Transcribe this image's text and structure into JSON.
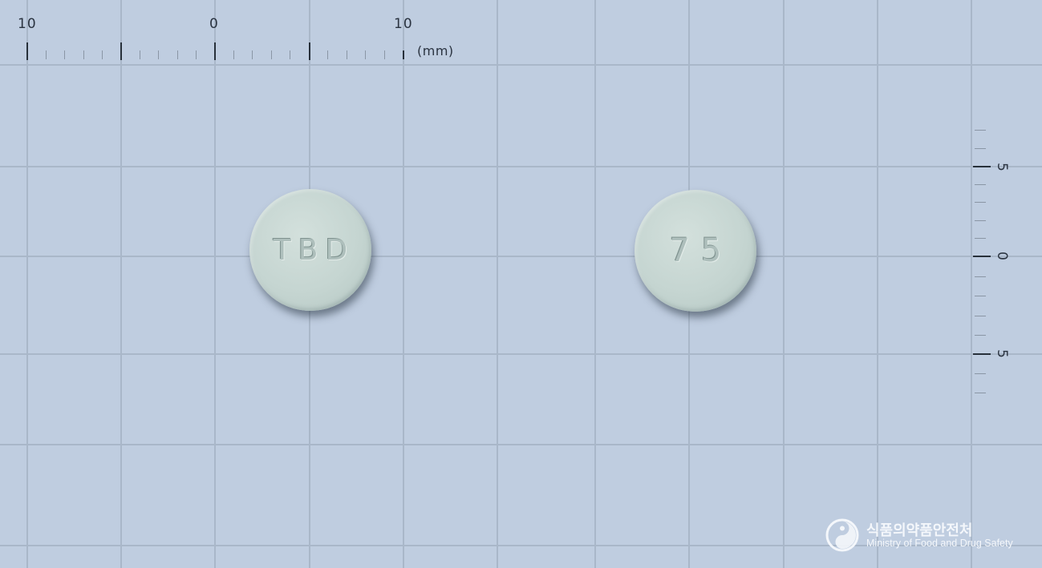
{
  "ruler_top": {
    "labels": [
      "10",
      "0",
      "10"
    ],
    "unit": "(mm)"
  },
  "ruler_right": {
    "labels": [
      "5",
      "0",
      "5"
    ]
  },
  "pills": [
    {
      "imprint": "TBD",
      "color": "#c8d8d4"
    },
    {
      "imprint": "75",
      "color": "#c8d8d4"
    }
  ],
  "watermark": {
    "name_ko": "식품의약품안전처",
    "name_en": "Ministry of Food and Drug Safety",
    "logo": "mfds-taegeuk-logo"
  },
  "colors": {
    "background": "#bfcde0",
    "grid": "#a9b7c9",
    "ruler": "#27303a"
  }
}
